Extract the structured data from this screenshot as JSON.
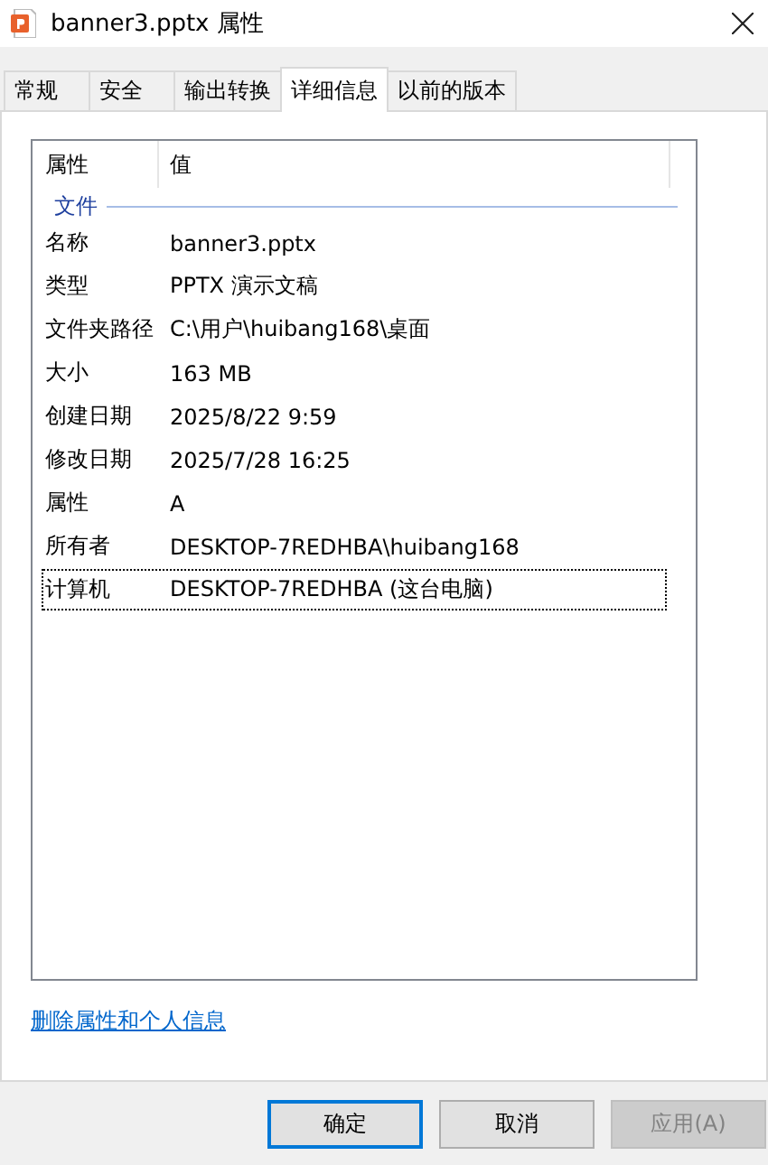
{
  "window": {
    "title": "banner3.pptx 属性"
  },
  "tabs": [
    {
      "label": "常规",
      "selected": false
    },
    {
      "label": "安全",
      "selected": false
    },
    {
      "label": "输出转换",
      "selected": false
    },
    {
      "label": "详细信息",
      "selected": true
    },
    {
      "label": "以前的版本",
      "selected": false
    }
  ],
  "list": {
    "columns": [
      "属性",
      "值"
    ],
    "group": "文件",
    "rows": [
      {
        "name": "名称",
        "value": "banner3.pptx",
        "selected": false
      },
      {
        "name": "类型",
        "value": "PPTX 演示文稿",
        "selected": false
      },
      {
        "name": "文件夹路径",
        "value": "C:\\用户\\huibang168\\桌面",
        "selected": false
      },
      {
        "name": "大小",
        "value": "163 MB",
        "selected": false
      },
      {
        "name": "创建日期",
        "value": "2025/8/22 9:59",
        "selected": false
      },
      {
        "name": "修改日期",
        "value": "2025/7/28 16:25",
        "selected": false
      },
      {
        "name": "属性",
        "value": "A",
        "selected": false
      },
      {
        "name": "所有者",
        "value": "DESKTOP-7REDHBA\\huibang168",
        "selected": false
      },
      {
        "name": "计算机",
        "value": "DESKTOP-7REDHBA (这台电脑)",
        "selected": true
      }
    ]
  },
  "link": "删除属性和个人信息",
  "buttons": [
    {
      "label": "确定",
      "default": true,
      "disabled": false
    },
    {
      "label": "取消",
      "default": false,
      "disabled": false
    },
    {
      "label": "应用(A)",
      "default": false,
      "disabled": true
    }
  ]
}
